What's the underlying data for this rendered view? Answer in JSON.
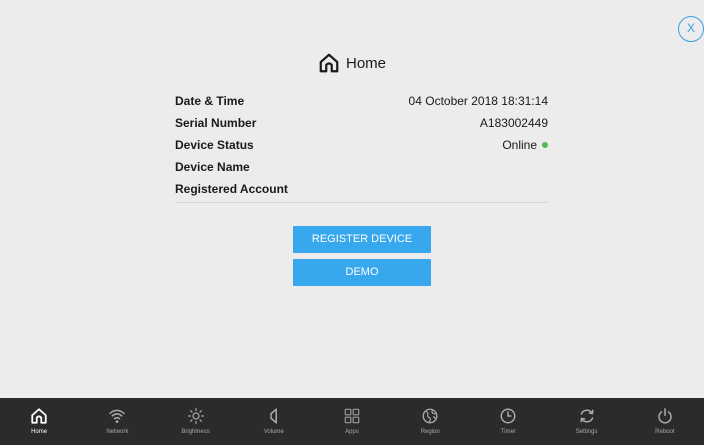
{
  "header": {
    "close_label": "X",
    "title": "Home"
  },
  "info": {
    "rows": [
      {
        "label": "Date & Time",
        "value": "04 October 2018 18:31:14"
      },
      {
        "label": "Serial Number",
        "value": "A183002449"
      },
      {
        "label": "Device Status",
        "value": "Online"
      },
      {
        "label": "Device Name",
        "value": ""
      },
      {
        "label": "Registered Account",
        "value": ""
      }
    ],
    "status_color": "#4cbb5a"
  },
  "actions": {
    "register_label": "REGISTER DEVICE",
    "demo_label": "DEMO"
  },
  "nav": {
    "items": [
      {
        "label": "Home",
        "icon": "home-icon",
        "active": true
      },
      {
        "label": "Network",
        "icon": "wifi-icon",
        "active": false
      },
      {
        "label": "Brightness",
        "icon": "brightness-icon",
        "active": false
      },
      {
        "label": "Volume",
        "icon": "volume-icon",
        "active": false
      },
      {
        "label": "Apps",
        "icon": "apps-icon",
        "active": false
      },
      {
        "label": "Region",
        "icon": "globe-icon",
        "active": false
      },
      {
        "label": "Timer",
        "icon": "clock-icon",
        "active": false
      },
      {
        "label": "Settings",
        "icon": "refresh-icon",
        "active": false
      },
      {
        "label": "Reboot",
        "icon": "power-icon",
        "active": false
      }
    ]
  },
  "colors": {
    "accent": "#38a8ee",
    "bar_background": "#2b2b2b",
    "panel_background": "#ececec"
  }
}
